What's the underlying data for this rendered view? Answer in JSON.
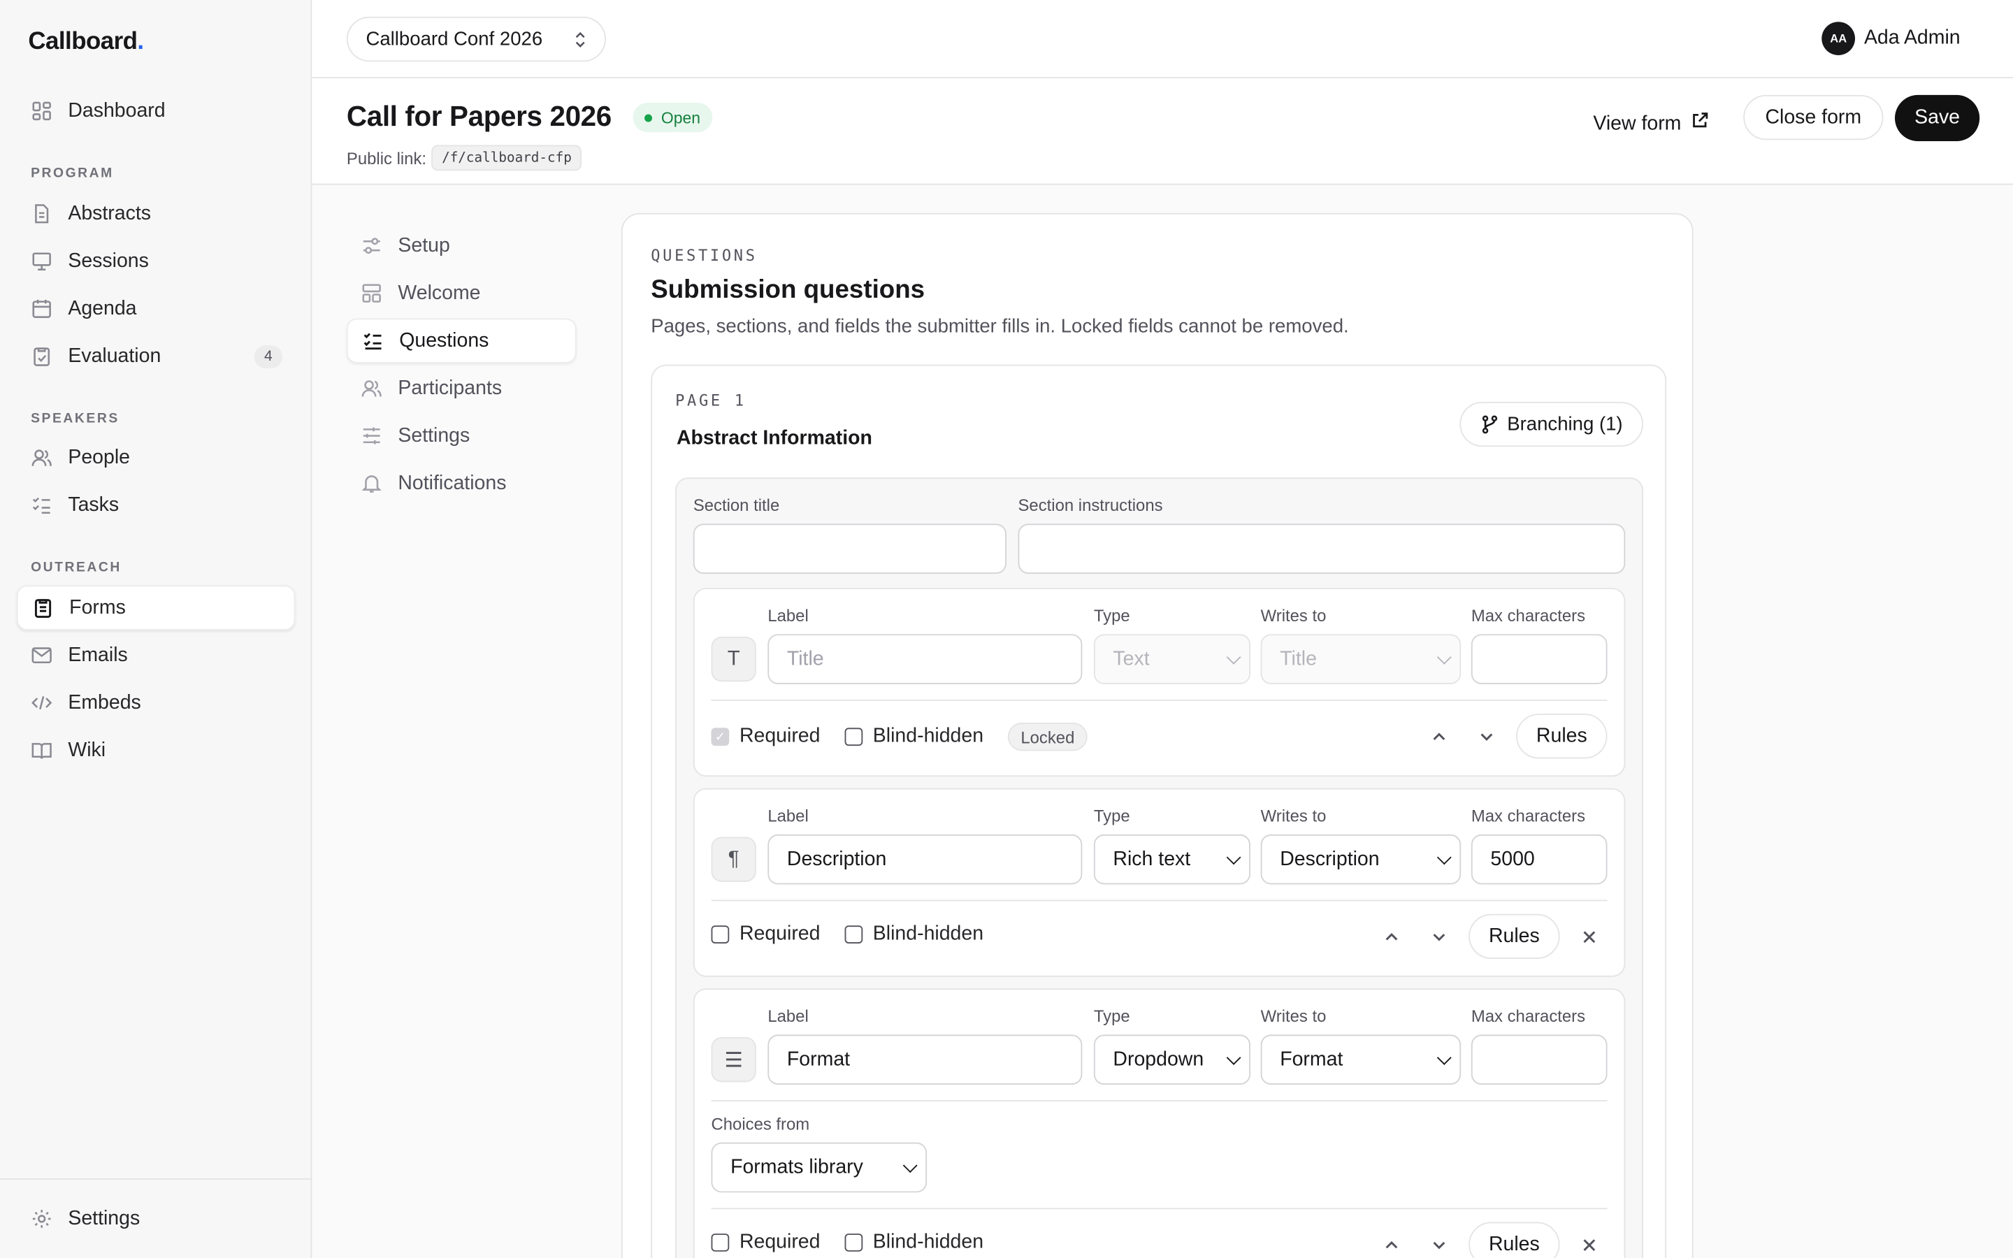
{
  "brand": {
    "name": "Callboard",
    "dot": "."
  },
  "sidebar": {
    "items": [
      {
        "label": "Dashboard"
      },
      {
        "heading": "PROGRAM"
      },
      {
        "label": "Abstracts"
      },
      {
        "label": "Sessions"
      },
      {
        "label": "Agenda"
      },
      {
        "label": "Evaluation",
        "badge": "4"
      },
      {
        "heading": "SPEAKERS"
      },
      {
        "label": "People"
      },
      {
        "label": "Tasks"
      },
      {
        "heading": "OUTREACH"
      },
      {
        "label": "Forms",
        "active": true
      },
      {
        "label": "Emails"
      },
      {
        "label": "Embeds"
      },
      {
        "label": "Wiki"
      }
    ],
    "footer": {
      "label": "Settings"
    }
  },
  "topbar": {
    "conference": "Callboard Conf 2026",
    "user": {
      "initials": "AA",
      "name": "Ada Admin"
    }
  },
  "header": {
    "title": "Call for Papers 2026",
    "status": "Open",
    "public_link_label": "Public link:",
    "public_link": "/f/callboard-cfp",
    "view_form": "View form",
    "close_form": "Close form",
    "save": "Save"
  },
  "subnav": [
    {
      "label": "Setup"
    },
    {
      "label": "Welcome"
    },
    {
      "label": "Questions",
      "active": true
    },
    {
      "label": "Participants"
    },
    {
      "label": "Settings"
    },
    {
      "label": "Notifications"
    }
  ],
  "questions": {
    "eyebrow": "QUESTIONS",
    "title": "Submission questions",
    "description": "Pages, sections, and fields the submitter fills in. Locked fields cannot be removed.",
    "page": {
      "eyebrow": "PAGE 1",
      "name": "Abstract Information",
      "branching": "Branching (1)",
      "section": {
        "title_label": "Section title",
        "title_value": "",
        "instructions_label": "Section instructions",
        "instructions_value": "",
        "fields": [
          {
            "icon": "text-type-icon",
            "glyph": "T",
            "label_label": "Label",
            "label_placeholder": "Title",
            "type_label": "Type",
            "type_value": "Text",
            "writes_label": "Writes to",
            "writes_value": "Title",
            "max_label": "Max characters",
            "max_value": "",
            "required": "Required",
            "required_checked": true,
            "blind": "Blind-hidden",
            "locked": "Locked",
            "rules": "Rules"
          },
          {
            "icon": "paragraph-icon",
            "glyph": "¶",
            "label_label": "Label",
            "label_value": "Description",
            "type_label": "Type",
            "type_value": "Rich text",
            "writes_label": "Writes to",
            "writes_value": "Description",
            "max_label": "Max characters",
            "max_value": "5000",
            "required": "Required",
            "blind": "Blind-hidden",
            "rules": "Rules"
          },
          {
            "icon": "list-icon",
            "glyph": "☰",
            "label_label": "Label",
            "label_value": "Format",
            "type_label": "Type",
            "type_value": "Dropdown",
            "writes_label": "Writes to",
            "writes_value": "Format",
            "max_label": "Max characters",
            "max_value": "",
            "choices_label": "Choices from",
            "choices_value": "Formats library",
            "required": "Required",
            "blind": "Blind-hidden",
            "rules": "Rules"
          }
        ]
      }
    }
  }
}
